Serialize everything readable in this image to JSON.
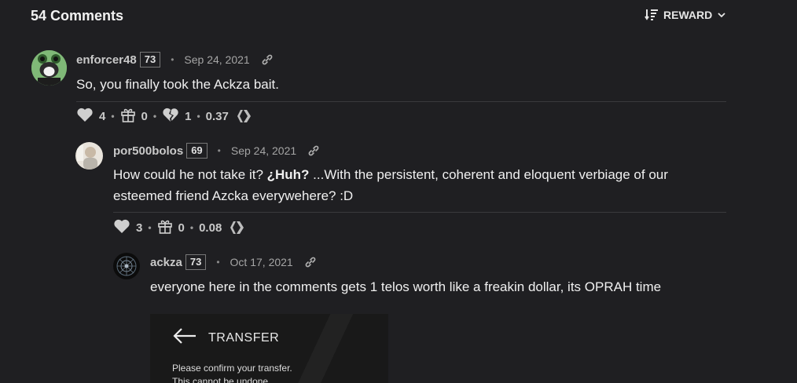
{
  "header": {
    "comments_title": "54 Comments",
    "sort_label": "REWARD"
  },
  "comments": [
    {
      "author": "enforcer48",
      "reputation": "73",
      "date": "Sep 24, 2021",
      "body": "So, you finally took the Ackza bait.",
      "votes": "4",
      "gifts": "0",
      "downvotes": "1",
      "payout": "0.37"
    },
    {
      "author": "por500bolos",
      "reputation": "69",
      "date": "Sep 24, 2021",
      "body_prefix": "How could he not take it? ",
      "body_bold": "¿Huh?",
      "body_suffix": " ...With the persistent, coherent and eloquent verbiage of our",
      "body_line2": "esteemed friend Azcka everywehere? :D",
      "votes": "3",
      "gifts": "0",
      "payout": "0.08"
    },
    {
      "author": "ackza",
      "reputation": "73",
      "date": "Oct 17, 2021",
      "body": "everyone here in the comments gets 1 telos worth like a freakin dollar, its OPRAH time",
      "image": {
        "heading": "TRANSFER",
        "line1": "Please confirm your transfer.",
        "line2": "This cannot be undone."
      }
    }
  ],
  "icons": {
    "sort": "sort-icon",
    "chevron": "chevron-down-icon",
    "heart": "heart-icon",
    "gift": "gift-icon",
    "broken_heart": "broken-heart-icon",
    "link": "link-icon",
    "hive": "hive-icon",
    "arrow": "arrow-left-icon"
  },
  "colors": {
    "background": "#1f1f22",
    "text": "#f0f0f0",
    "muted": "#a5a5a5"
  }
}
